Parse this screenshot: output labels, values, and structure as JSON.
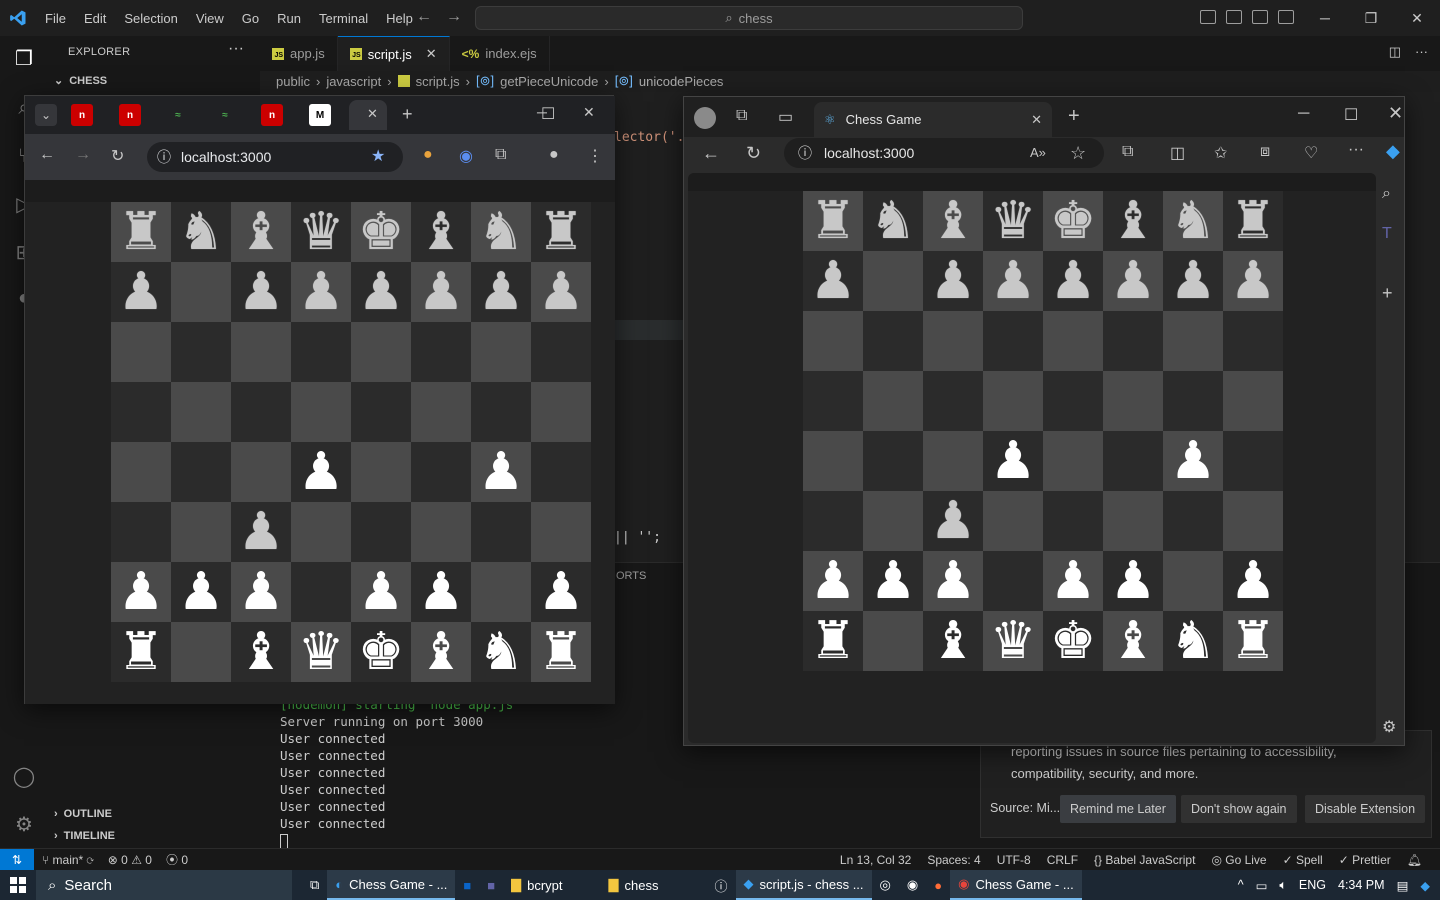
{
  "vscode": {
    "menu": [
      "File",
      "Edit",
      "Selection",
      "View",
      "Go",
      "Run",
      "Terminal",
      "Help"
    ],
    "search_text": "chess",
    "explorer_title": "EXPLORER",
    "workspace": "CHESS",
    "outline": "OUTLINE",
    "timeline": "TIMELINE",
    "tabs": [
      {
        "label": "app.js",
        "kind": "js"
      },
      {
        "label": "script.js",
        "kind": "js",
        "active": true
      },
      {
        "label": "index.ejs",
        "kind": "ejs"
      }
    ],
    "breadcrumb": [
      "public",
      "javascript",
      "script.js",
      "getPieceUnicode",
      "unicodePieces"
    ],
    "code_fragment_1": "lector('.",
    "code_fragment_2": "|| '';",
    "panel_tab": "ORTS",
    "terminal_lines": [
      "[nodemon] starting `node app.js`",
      "Server running on port 3000",
      "User connected",
      "User connected",
      "User connected",
      "User connected",
      "User connected",
      "User connected"
    ],
    "toast": {
      "line1": "reporting issues in source files pertaining to accessibility,",
      "line2": "compatibility, security, and more.",
      "source": "Source: Mi...",
      "btn_remind": "Remind me Later",
      "btn_dont": "Don't show again",
      "btn_disable": "Disable Extension"
    },
    "status": {
      "branch": "main*",
      "errors": "0",
      "warnings": "0",
      "ports": "0",
      "position": "Ln 13, Col 32",
      "spaces": "Spaces: 4",
      "encoding": "UTF-8",
      "eol": "CRLF",
      "language": "Babel JavaScript",
      "golive": "Go Live",
      "spell": "Spell",
      "prettier": "Prettier"
    }
  },
  "chrome": {
    "url": "localhost:3000"
  },
  "edge": {
    "tab_title": "Chess Game",
    "url": "localhost:3000"
  },
  "boards": {
    "left": [
      [
        "♜",
        "♞",
        "♝",
        "♛",
        "♚",
        "♝",
        "♞",
        "♜"
      ],
      [
        "♟",
        "",
        "♟",
        "♟",
        "♟",
        "♟",
        "♟",
        "♟"
      ],
      [
        "",
        "",
        "",
        "",
        "",
        "",
        "",
        ""
      ],
      [
        "",
        "",
        "",
        "",
        "",
        "",
        "",
        ""
      ],
      [
        "",
        "",
        "",
        "♟",
        "",
        "",
        "♟",
        ""
      ],
      [
        "",
        "",
        "♟",
        "",
        "",
        "",
        "",
        ""
      ],
      [
        "♟",
        "♟",
        "♟",
        "",
        "♟",
        "♟",
        "",
        "♟"
      ],
      [
        "♜",
        "",
        "♝",
        "♛",
        "♚",
        "♝",
        "♞",
        "♜"
      ]
    ],
    "left_colors": [
      [
        "b",
        "b",
        "b",
        "b",
        "b",
        "b",
        "b",
        "b"
      ],
      [
        "b",
        "",
        "b",
        "b",
        "b",
        "b",
        "b",
        "b"
      ],
      [
        "",
        "",
        "",
        "",
        "",
        "",
        "",
        ""
      ],
      [
        "",
        "",
        "",
        "",
        "",
        "",
        "",
        ""
      ],
      [
        "",
        "",
        "",
        "w",
        "",
        "",
        "w",
        ""
      ],
      [
        "",
        "",
        "b",
        "",
        "",
        "",
        "",
        ""
      ],
      [
        "w",
        "w",
        "w",
        "",
        "w",
        "w",
        "",
        "w"
      ],
      [
        "w",
        "",
        "w",
        "w",
        "w",
        "w",
        "w",
        "w"
      ]
    ],
    "right": [
      [
        "♜",
        "♞",
        "♝",
        "♛",
        "♚",
        "♝",
        "♞",
        "♜"
      ],
      [
        "♟",
        "",
        "♟",
        "♟",
        "♟",
        "♟",
        "♟",
        "♟"
      ],
      [
        "",
        "",
        "",
        "",
        "",
        "",
        "",
        ""
      ],
      [
        "",
        "",
        "",
        "",
        "",
        "",
        "",
        ""
      ],
      [
        "",
        "",
        "",
        "♟",
        "",
        "",
        "♟",
        ""
      ],
      [
        "",
        "",
        "♟",
        "",
        "",
        "",
        "",
        ""
      ],
      [
        "♟",
        "♟",
        "♟",
        "",
        "♟",
        "♟",
        "",
        "♟"
      ],
      [
        "♜",
        "",
        "♝",
        "♛",
        "♚",
        "♝",
        "♞",
        "♜"
      ]
    ],
    "right_colors": [
      [
        "b",
        "b",
        "b",
        "b",
        "b",
        "b",
        "b",
        "b"
      ],
      [
        "b",
        "",
        "b",
        "b",
        "b",
        "b",
        "b",
        "b"
      ],
      [
        "",
        "",
        "",
        "",
        "",
        "",
        "",
        ""
      ],
      [
        "",
        "",
        "",
        "",
        "",
        "",
        "",
        ""
      ],
      [
        "",
        "",
        "",
        "w",
        "",
        "",
        "w",
        ""
      ],
      [
        "",
        "",
        "b",
        "",
        "",
        "",
        "",
        ""
      ],
      [
        "w",
        "w",
        "w",
        "",
        "w",
        "w",
        "",
        "w"
      ],
      [
        "w",
        "",
        "w",
        "w",
        "w",
        "w",
        "w",
        "w"
      ]
    ]
  },
  "taskbar": {
    "search": "Search",
    "apps": [
      "Chess Game - ...",
      "bcrypt",
      "chess",
      "script.js - chess ...",
      "Chess Game - ..."
    ],
    "lang": "ENG",
    "time": "4:34 PM"
  },
  "colors": {
    "accent": "#0078d4",
    "light_square": "#4a4a4a",
    "dark_square": "#2b2b2b"
  }
}
